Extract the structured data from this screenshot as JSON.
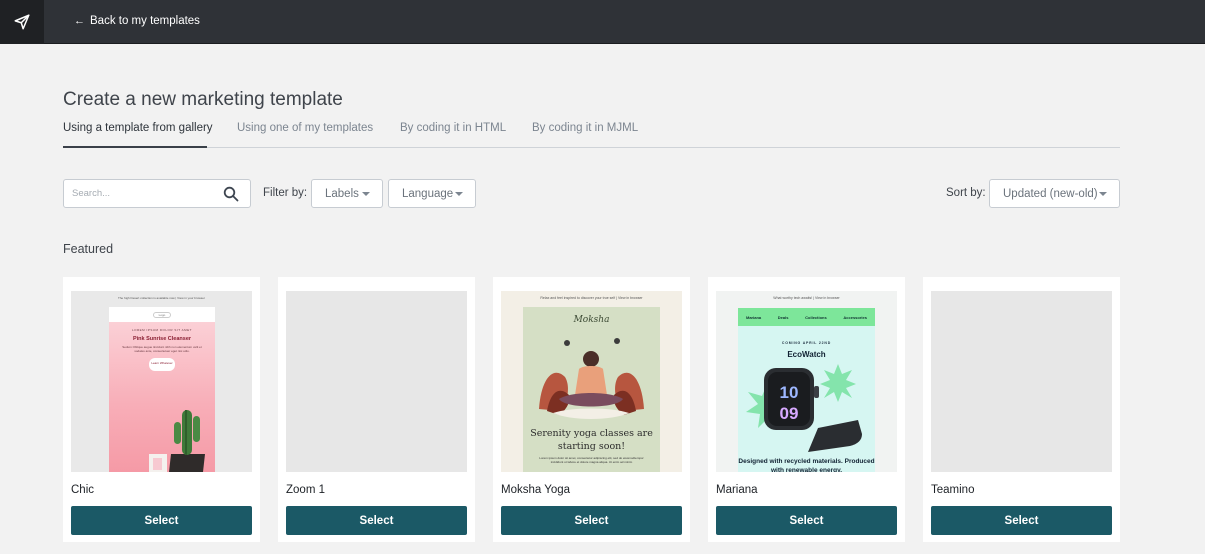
{
  "topbar": {
    "logo_icon": "paper-plane-icon",
    "back_label": "Back to my templates",
    "back_icon": "←"
  },
  "page": {
    "title": "Create a new marketing template"
  },
  "tabs": [
    {
      "label": "Using a template from gallery",
      "active": true
    },
    {
      "label": "Using one of my templates",
      "active": false
    },
    {
      "label": "By coding it in HTML",
      "active": false
    },
    {
      "label": "By coding it in MJML",
      "active": false
    }
  ],
  "filters": {
    "search_placeholder": "Search...",
    "filter_by_label": "Filter by:",
    "labels_dropdown": "Labels",
    "language_dropdown": "Language",
    "sort_by_label": "Sort by:",
    "sort_value": "Updated (new-old)"
  },
  "section": {
    "featured_label": "Featured"
  },
  "templates": [
    {
      "name": "Chic",
      "select_label": "Select",
      "preview": {
        "preheader": "The high Desert collection is available now | View in your browser",
        "logo": "Logo",
        "tag": "LOREM IPSUM DOLOR SIT AMET",
        "title": "Pink Sunrise Cleanser",
        "body": "Sedum Oblique augue tincidunt nibh non elementum velit et sodales ante, consectetuer eget nisi odio.",
        "button": "Learn Whatever"
      }
    },
    {
      "name": "Zoom 1",
      "select_label": "Select"
    },
    {
      "name": "Moksha Yoga",
      "select_label": "Select",
      "preview": {
        "preheader": "Relax and feel inspired to discover your true self | View in browser",
        "logo": "Moksha",
        "headline": "Serenity yoga classes are starting soon!",
        "body": "Lorem ipsum dolor sit amet, consectetur adipiscing elit, sed do eiusmodtempor incididunt ut labore et dolore magna aliqua. Ut enim ad minim"
      }
    },
    {
      "name": "Mariana",
      "select_label": "Select",
      "preview": {
        "preheader": "What worthy tech awaits! | View in browser",
        "nav": [
          "Mariana",
          "Deals",
          "Collections",
          "Accessories"
        ],
        "coming": "COMING APRIL 22ND",
        "brand": "EcoWatch",
        "watch_time_top": "10",
        "watch_time_bottom": "09",
        "tagline": "Designed with recycled materials. Produced with renewable energy."
      }
    },
    {
      "name": "Teamino",
      "select_label": "Select"
    }
  ],
  "colors": {
    "topbar": "#2f3237",
    "select_button": "#1b5966",
    "background": "#f2f2f2"
  }
}
